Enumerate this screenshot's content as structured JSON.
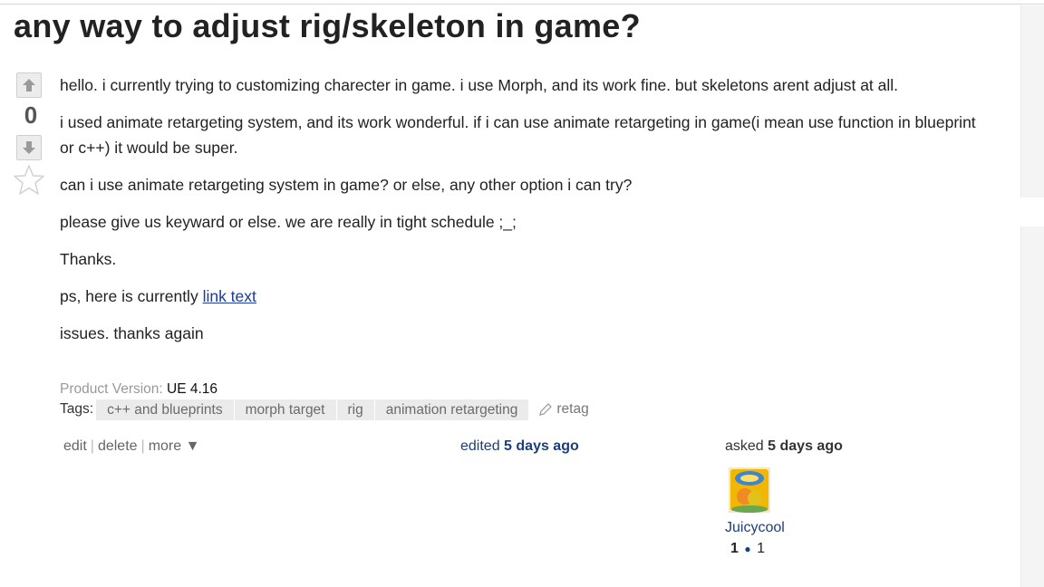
{
  "question": {
    "title": "any way to adjust rig/skeleton in game?",
    "vote_count": "0",
    "paragraphs": [
      "hello. i currently trying to customizing charecter in game. i use Morph, and its work fine. but skeletons arent adjust at all.",
      "i used animate retargeting system, and its work wonderful. if i can use animate retargeting in game(i mean use function in blueprint or c++) it would be super.",
      "can i use animate retargeting system in game? or else, any other option i can try?",
      "please give us keyward or else. we are really in tight schedule ;_;",
      "Thanks."
    ],
    "ps_prefix": "ps, here is currently ",
    "ps_link": "link text",
    "last_line": "issues. thanks again"
  },
  "meta": {
    "product_version_label": "Product Version:",
    "product_version": "UE 4.16",
    "tags_label": "Tags:",
    "tags": [
      "c++ and blueprints",
      "morph target",
      "rig",
      "animation retargeting"
    ],
    "retag_label": "retag"
  },
  "actions": {
    "edit": "edit",
    "delete": "delete",
    "more": "more ▼",
    "separator": "|"
  },
  "edited": {
    "label": "edited",
    "when": "5 days ago"
  },
  "asked": {
    "label": "asked",
    "when": "5 days ago"
  },
  "author": {
    "name": "Juicycool",
    "reputation": "1",
    "badges": "1",
    "dot": "●"
  },
  "icons": {
    "vote_up": "arrow-up-icon",
    "vote_down": "arrow-down-icon",
    "favorite": "star-icon",
    "retag": "pencil-icon"
  },
  "colors": {
    "link": "#1a3a9c",
    "user": "#1b3f7a",
    "tag_bg": "#ebebeb"
  }
}
